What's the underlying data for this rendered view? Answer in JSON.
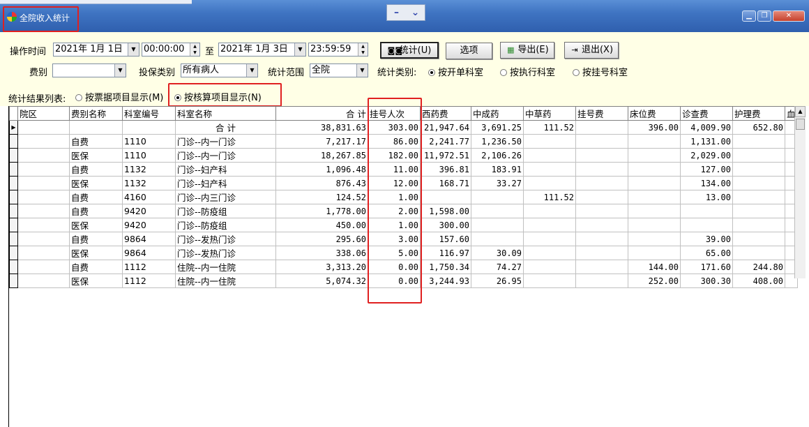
{
  "window": {
    "title": "全院收入统计",
    "center_minimize": "–",
    "center_dropdown": "⌄",
    "min_label": "▁",
    "max_label": "❐",
    "close_label": "✕"
  },
  "filters": {
    "op_time_label": "操作时间",
    "start_date": "2021年 1月 1日",
    "start_time": "00:00:00",
    "to_label": "至",
    "end_date": "2021年 1月 3日",
    "end_time": "23:59:59",
    "fee_type_label": "费别",
    "fee_type_value": "",
    "insurance_label": "投保类别",
    "insurance_value": "所有病人",
    "scope_label": "统计范围",
    "scope_value": "全院",
    "stat_type_label": "统计类别:",
    "stat_type_options": [
      "按开单科室",
      "按执行科室",
      "按挂号科室"
    ],
    "stat_type_selected": 0,
    "result_list_label": "统计结果列表:",
    "display_options": [
      "按票据项目显示(M)",
      "按核算项目显示(N)"
    ],
    "display_selected": 1
  },
  "buttons": {
    "stats": "统计(U)",
    "options": "选项",
    "export": "导出(E)",
    "exit": "退出(X)"
  },
  "table": {
    "headers": [
      "院区",
      "费别名称",
      "科室编号",
      "科室名称",
      "合  计",
      "挂号人次",
      "西药费",
      "中成药",
      "中草药",
      "挂号费",
      "床位费",
      "诊查费",
      "护理费",
      "血"
    ],
    "total_row": {
      "label": "合  计",
      "values": [
        "38,831.63",
        "303.00",
        "21,947.64",
        "3,691.25",
        "111.52",
        "",
        "396.00",
        "4,009.90",
        "652.80"
      ]
    },
    "rows": [
      [
        "",
        "自费",
        "1110",
        "门诊--内一门诊",
        "7,217.17",
        "86.00",
        "2,241.77",
        "1,236.50",
        "",
        "",
        "",
        "1,131.00",
        ""
      ],
      [
        "",
        "医保",
        "1110",
        "门诊--内一门诊",
        "18,267.85",
        "182.00",
        "11,972.51",
        "2,106.26",
        "",
        "",
        "",
        "2,029.00",
        ""
      ],
      [
        "",
        "自费",
        "1132",
        "门诊--妇产科",
        "1,096.48",
        "11.00",
        "396.81",
        "183.91",
        "",
        "",
        "",
        "127.00",
        ""
      ],
      [
        "",
        "医保",
        "1132",
        "门诊--妇产科",
        "876.43",
        "12.00",
        "168.71",
        "33.27",
        "",
        "",
        "",
        "134.00",
        ""
      ],
      [
        "",
        "自费",
        "4160",
        "门诊--内三门诊",
        "124.52",
        "1.00",
        "",
        "",
        "111.52",
        "",
        "",
        "13.00",
        ""
      ],
      [
        "",
        "自费",
        "9420",
        "门诊--防疫组",
        "1,778.00",
        "2.00",
        "1,598.00",
        "",
        "",
        "",
        "",
        "",
        ""
      ],
      [
        "",
        "医保",
        "9420",
        "门诊--防疫组",
        "450.00",
        "1.00",
        "300.00",
        "",
        "",
        "",
        "",
        "",
        ""
      ],
      [
        "",
        "自费",
        "9864",
        "门诊--发热门诊",
        "295.60",
        "3.00",
        "157.60",
        "",
        "",
        "",
        "",
        "39.00",
        ""
      ],
      [
        "",
        "医保",
        "9864",
        "门诊--发热门诊",
        "338.06",
        "5.00",
        "116.97",
        "30.09",
        "",
        "",
        "",
        "65.00",
        ""
      ],
      [
        "",
        "自费",
        "1112",
        "住院--内一住院",
        "3,313.20",
        "0.00",
        "1,750.34",
        "74.27",
        "",
        "",
        "144.00",
        "171.60",
        "244.80"
      ],
      [
        "",
        "医保",
        "1112",
        "住院--内一住院",
        "5,074.32",
        "0.00",
        "3,244.93",
        "26.95",
        "",
        "",
        "252.00",
        "300.30",
        "408.00"
      ]
    ]
  },
  "colors": {
    "title_bar": "#3f74c2",
    "panel_bg": "#ffffe6",
    "highlight_box": "#e02020"
  }
}
